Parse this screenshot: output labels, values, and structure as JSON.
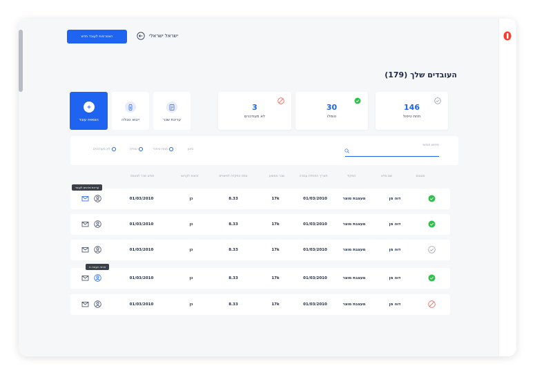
{
  "header": {
    "new_employee_button": "הצטרפות לעובד חדש",
    "company_name": "ישראל ישראלי"
  },
  "page_title": "העובדים שלך (179)",
  "stats": [
    {
      "value": "146",
      "label": "תחת טיפול",
      "icon": "check-circle-outline-icon"
    },
    {
      "value": "30",
      "label": "טופלו",
      "icon": "check-circle-filled-icon"
    },
    {
      "value": "3",
      "label": "לא מעודכנים",
      "icon": "ban-icon"
    }
  ],
  "actions": [
    {
      "label": "עריכת שכר",
      "icon": "document-icon"
    },
    {
      "label": "ייבוא טבלה",
      "icon": "file-import-icon"
    },
    {
      "label": "הוספת עובד",
      "icon": "plus-icon"
    }
  ],
  "filters": {
    "search_label": "חיפוש חופשי",
    "filter_title": "סינון",
    "options": [
      "תחת טיפול",
      "טופלו",
      "לא מעודכנים"
    ]
  },
  "columns": [
    "סטטוס",
    "שם מלא",
    "תפקיד",
    "תאריך התחלת עבודה",
    "שכר ממוצע",
    "אחוז הפקדה לפיצויים",
    "זכאות לקרוש",
    "חודש שכר לוואמה"
  ],
  "rows": [
    {
      "status": "done",
      "name": "דוה מן",
      "role": "מעצבת מוצר",
      "start_date": "01/03/2010",
      "salary": "17k",
      "deposit": "8.33",
      "eligible": "כן",
      "month": "01/03/2010"
    },
    {
      "status": "done",
      "name": "דוה מן",
      "role": "מעצבת מוצר",
      "start_date": "01/03/2010",
      "salary": "17k",
      "deposit": "8.33",
      "eligible": "כן",
      "month": "01/03/2010"
    },
    {
      "status": "pending",
      "name": "דוה מן",
      "role": "מעצבת מוצר",
      "start_date": "01/03/2010",
      "salary": "17k",
      "deposit": "8.33",
      "eligible": "כן",
      "month": "01/03/2010"
    },
    {
      "status": "done",
      "name": "דוה מן",
      "role": "מעצבת מוצר",
      "start_date": "01/03/2010",
      "salary": "17k",
      "deposit": "8.33",
      "eligible": "כן",
      "month": "01/03/2010"
    },
    {
      "status": "blocked",
      "name": "דוה מן",
      "role": "מעצבת מוצר",
      "start_date": "01/03/2010",
      "salary": "17k",
      "deposit": "8.33",
      "eligible": "כן",
      "month": "01/03/2010"
    }
  ],
  "tooltips": {
    "mail": "עריכת פרטים לעובד",
    "profile": "פרטי העובד.ת"
  },
  "colors": {
    "accent": "#1e64f0",
    "success": "#2ec24a",
    "danger": "#f05a4a",
    "brand": "#ff3b30"
  }
}
